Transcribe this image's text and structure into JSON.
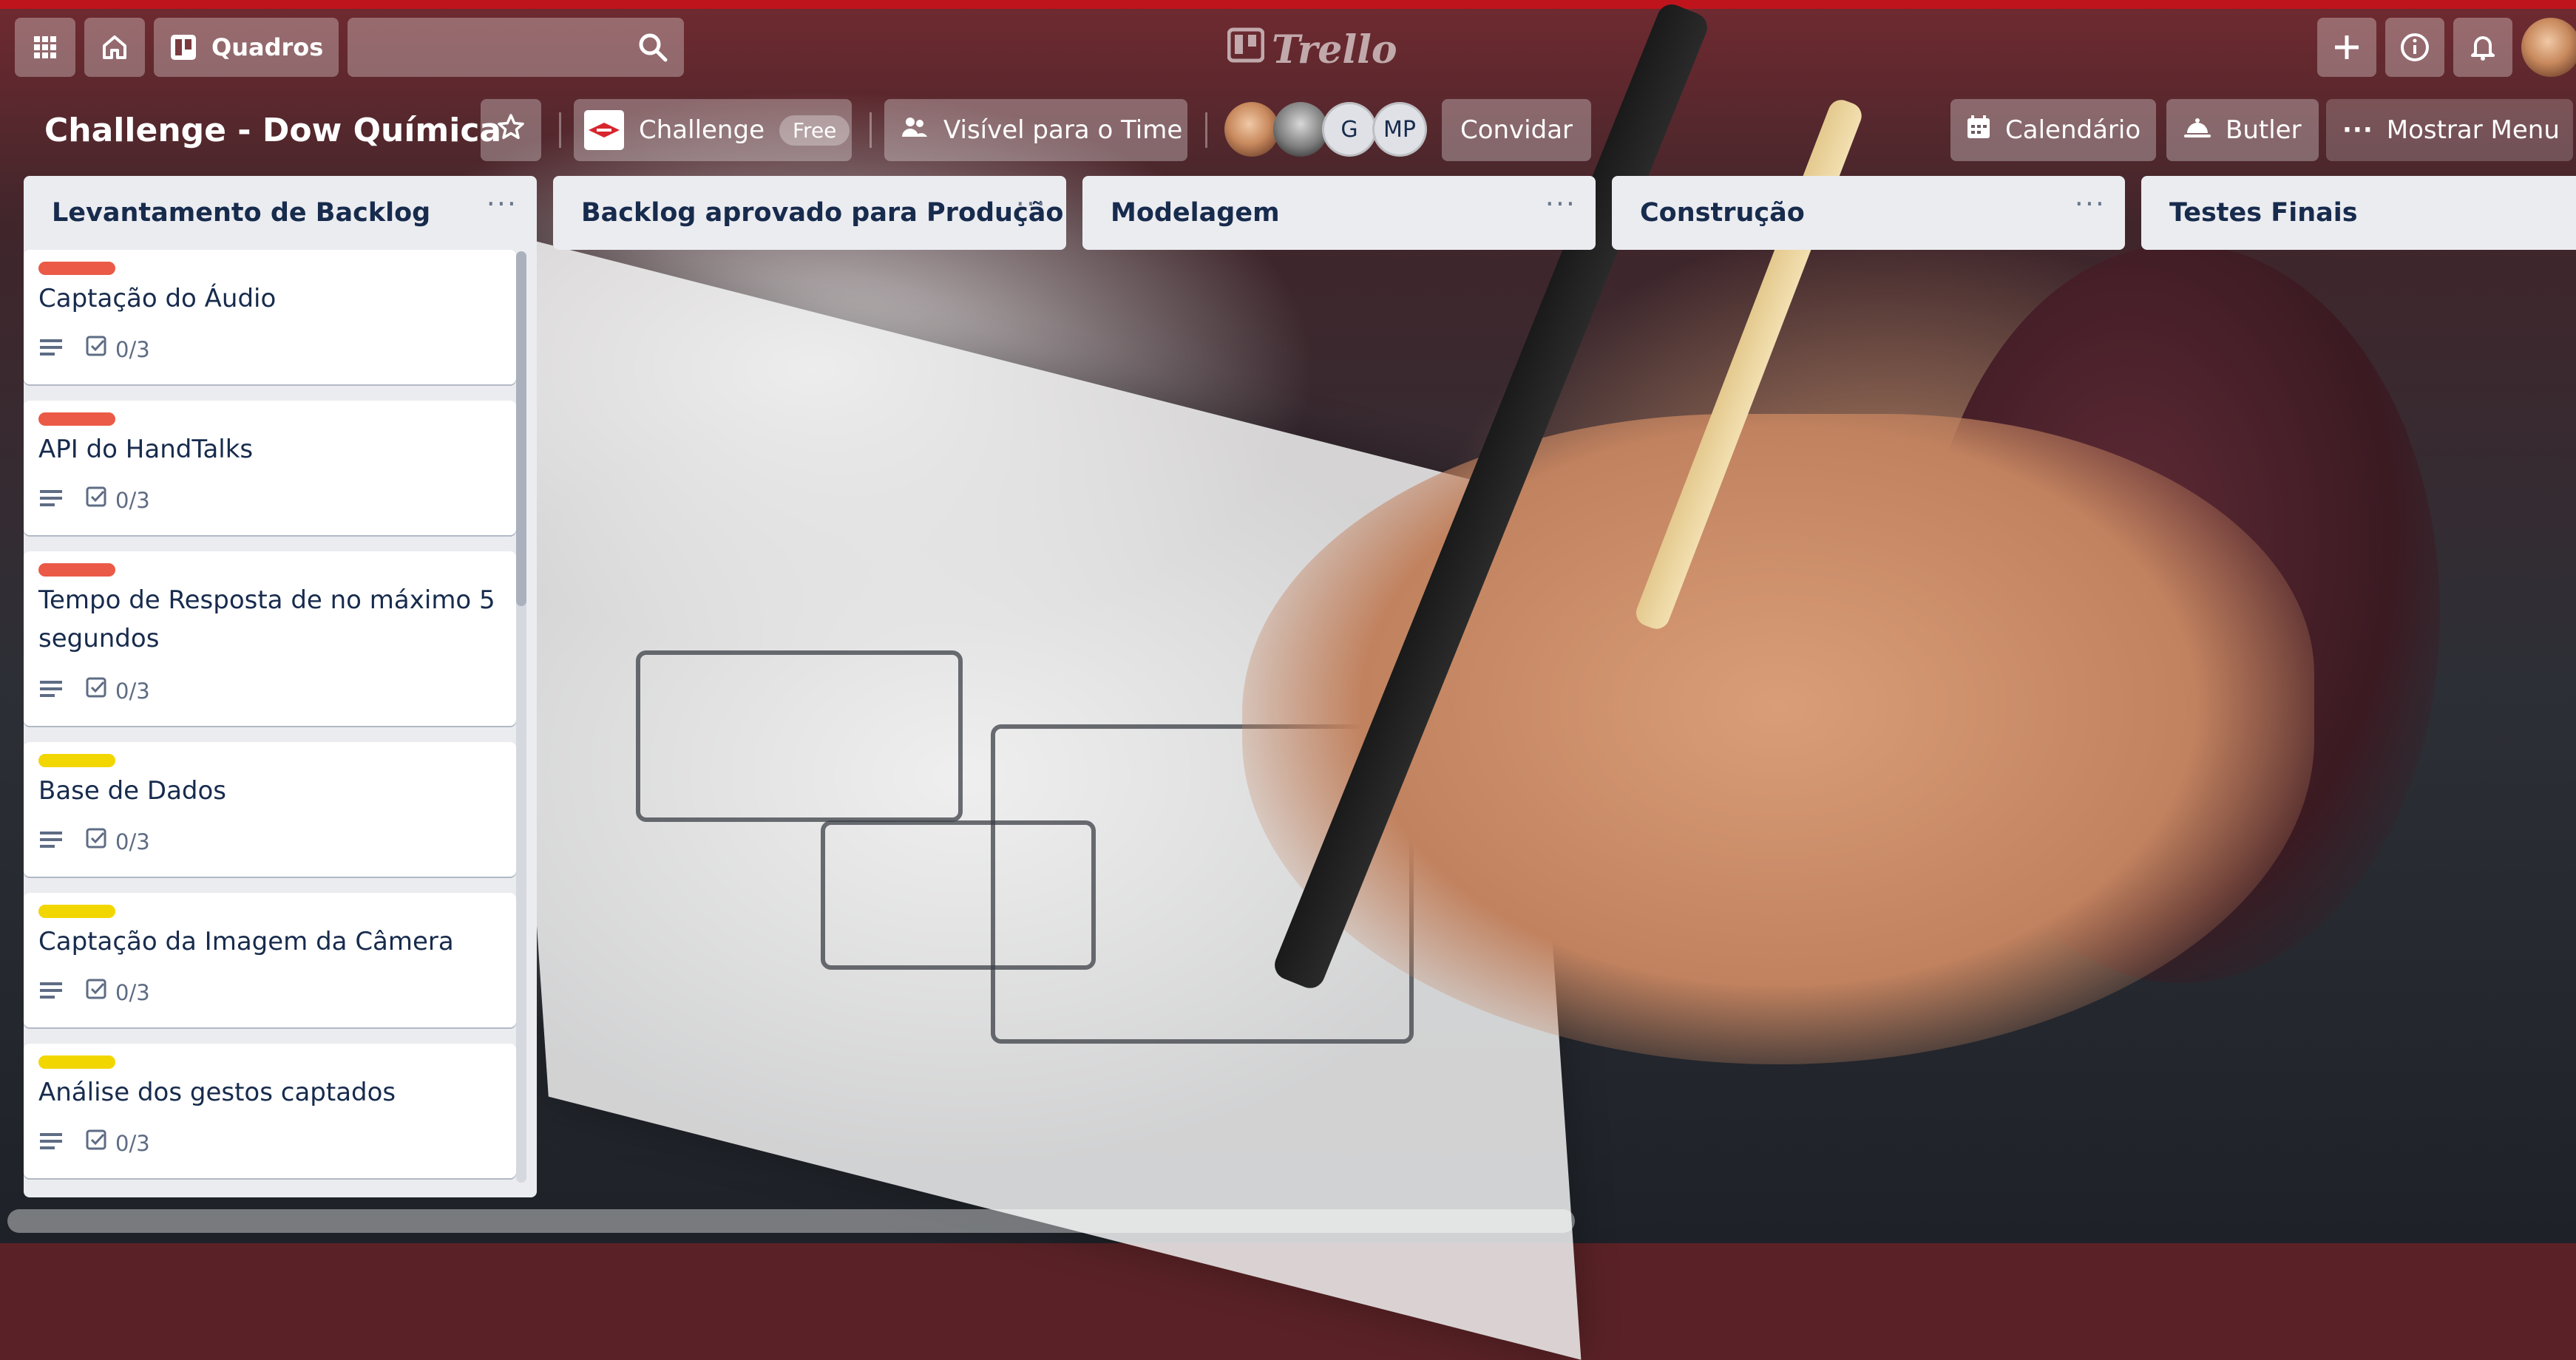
{
  "topbar": {
    "boards_label": "Quadros",
    "logo_text": "Trello"
  },
  "board": {
    "title": "Challenge - Dow Química",
    "workspace_name": "Challenge",
    "workspace_plan": "Free",
    "visibility": "Visível para o Time",
    "members": [
      {
        "type": "photo"
      },
      {
        "type": "photo"
      },
      {
        "initials": "G"
      },
      {
        "initials": "MP"
      }
    ],
    "invite_label": "Convidar",
    "calendar_label": "Calendário",
    "butler_label": "Butler",
    "menu_label": "Mostrar Menu"
  },
  "lists": [
    {
      "name": "Levantamento de Backlog",
      "cards": [
        {
          "label_color": "#eb5a46",
          "title": "Captação do Áudio",
          "checklist": "0/3"
        },
        {
          "label_color": "#eb5a46",
          "title": "API do HandTalks",
          "checklist": "0/3"
        },
        {
          "label_color": "#eb5a46",
          "title": "Tempo de Resposta de no máximo 5 segundos",
          "checklist": "0/3"
        },
        {
          "label_color": "#f2d600",
          "title": "Base de Dados",
          "checklist": "0/3"
        },
        {
          "label_color": "#f2d600",
          "title": "Captação da Imagem da Câmera",
          "checklist": "0/3"
        },
        {
          "label_color": "#f2d600",
          "title": "Análise dos gestos captados",
          "checklist": "0/3"
        }
      ]
    },
    {
      "name": "Backlog aprovado para Produção"
    },
    {
      "name": "Modelagem"
    },
    {
      "name": "Construção"
    },
    {
      "name": "Testes Finais"
    }
  ],
  "icons": {
    "apps": "grid-icon",
    "home": "home-icon",
    "boards": "board-icon",
    "search": "search-icon",
    "create": "plus-icon",
    "info": "info-icon",
    "notifications": "bell-icon",
    "star": "star-icon",
    "calendar": "calendar-icon",
    "butler": "butler-icon",
    "menu": "ellipsis-icon",
    "description": "description-icon",
    "checklist": "checklist-icon"
  },
  "colors": {
    "red_label": "#eb5a46",
    "yellow_label": "#f2d600",
    "list_bg": "#ebecf0",
    "text": "#172b4d"
  }
}
